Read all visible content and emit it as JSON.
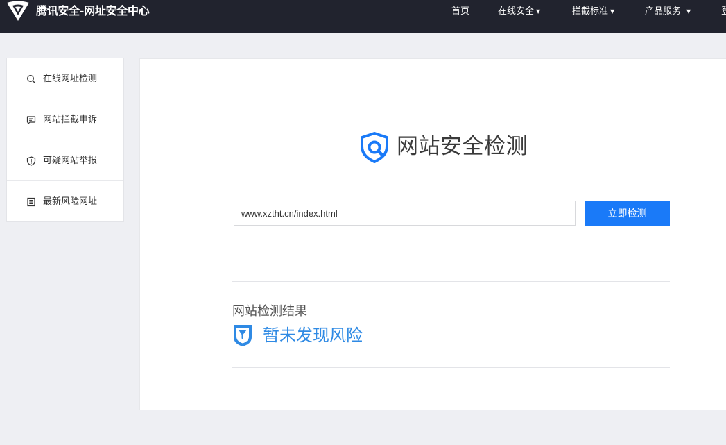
{
  "header": {
    "brand": "腾讯安全-网址安全中心",
    "nav": [
      {
        "label": "首页",
        "has_caret": false
      },
      {
        "label": "在线安全",
        "has_caret": true
      },
      {
        "label": "拦截标准",
        "has_caret": true
      },
      {
        "label": "产品服务",
        "has_caret": true
      },
      {
        "label": "登",
        "has_caret": false
      }
    ],
    "caret_glyph": "▼"
  },
  "sidebar": {
    "items": [
      {
        "label": "在线网址检测",
        "icon": "search-icon"
      },
      {
        "label": "网站拦截申诉",
        "icon": "chat-icon"
      },
      {
        "label": "可疑网站举报",
        "icon": "shield-alert-icon"
      },
      {
        "label": "最新风险网址",
        "icon": "document-list-icon"
      }
    ]
  },
  "main": {
    "title": "网站安全检测",
    "url_value": "www.xztht.cn/index.html",
    "check_button": "立即检测",
    "result_heading": "网站检测结果",
    "result_status": "暂未发现风险"
  },
  "colors": {
    "topbar": "#21232e",
    "accent": "#1a7af8",
    "result_text": "#2f8ae4",
    "background": "#eeeff3"
  }
}
